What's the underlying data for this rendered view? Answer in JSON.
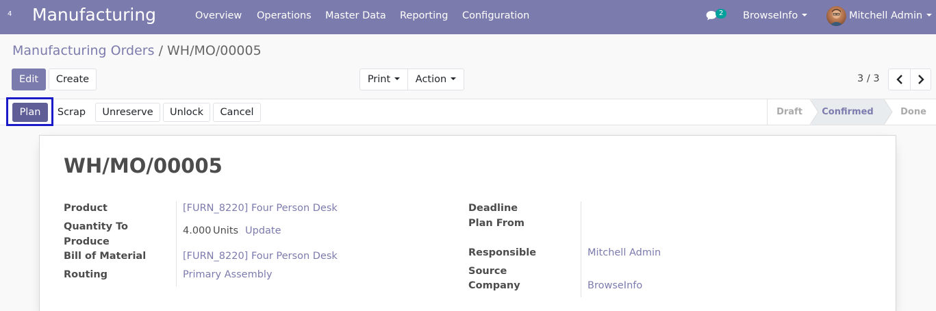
{
  "topbar": {
    "badge": "4",
    "app_title": "Manufacturing",
    "menu": [
      "Overview",
      "Operations",
      "Master Data",
      "Reporting",
      "Configuration"
    ],
    "chat_count": "2",
    "company": "BrowseInfo",
    "user": "Mitchell Admin",
    "color": "#7c7bad"
  },
  "breadcrumb": {
    "parent": "Manufacturing Orders",
    "separator": "/",
    "current": "WH/MO/00005"
  },
  "control": {
    "edit": "Edit",
    "create": "Create",
    "print": "Print",
    "action": "Action",
    "pager": "3 / 3"
  },
  "statusbar": {
    "buttons": [
      "Plan",
      "Scrap",
      "Unreserve",
      "Unlock",
      "Cancel"
    ],
    "stages": [
      "Draft",
      "Confirmed",
      "Done"
    ],
    "active_stage": "Confirmed"
  },
  "form": {
    "title": "WH/MO/00005",
    "product_label": "Product",
    "product_value": "[FURN_8220] Four Person Desk",
    "qty_label_1": "Quantity To",
    "qty_label_2": "Produce",
    "qty_value": "4.000",
    "qty_uom": "Units",
    "qty_update": "Update",
    "bom_label": "Bill of Material",
    "bom_value": "[FURN_8220] Four Person Desk",
    "routing_label": "Routing",
    "routing_value": "Primary Assembly",
    "deadline_label": "Deadline",
    "plan_from_label": "Plan From",
    "responsible_label": "Responsible",
    "responsible_value": "Mitchell Admin",
    "source_label": "Source",
    "company_label": "Company",
    "company_value": "BrowseInfo"
  }
}
